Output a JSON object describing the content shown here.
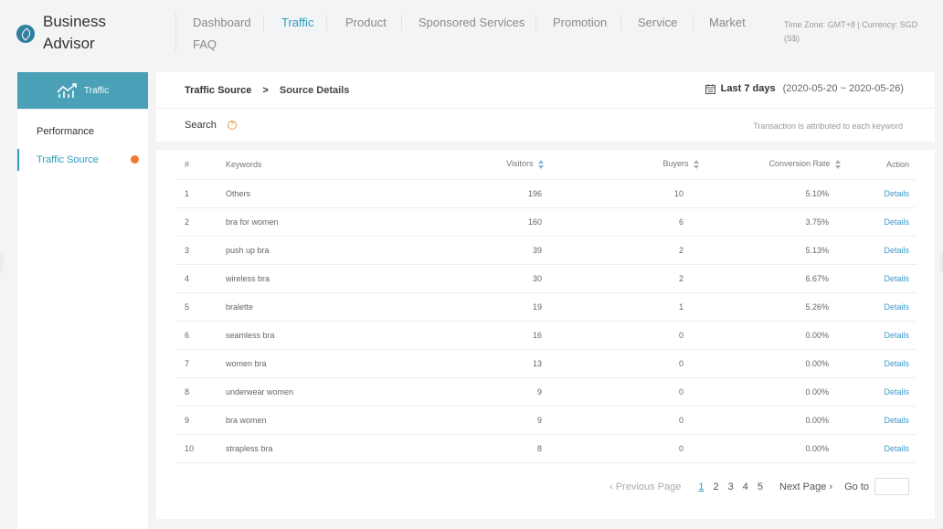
{
  "app": {
    "title_line1": "Business",
    "title_line2": "Advisor"
  },
  "nav": {
    "items": [
      {
        "label": "Dashboard",
        "active": false
      },
      {
        "label": "Traffic",
        "active": true
      },
      {
        "label": "Product",
        "active": false
      },
      {
        "label": "Sponsored Services",
        "active": false
      },
      {
        "label": "Promotion",
        "active": false
      },
      {
        "label": "Service",
        "active": false
      },
      {
        "label": "Market",
        "active": false
      },
      {
        "label": "FAQ",
        "active": false
      }
    ],
    "timezone_line1": "Time Zone: GMT+8 | Currency: SGD",
    "timezone_line2": "(S$)"
  },
  "sidebar": {
    "header_label": "Traffic",
    "items": [
      {
        "label": "Performance",
        "active": false
      },
      {
        "label": "Traffic Source",
        "active": true
      }
    ]
  },
  "breadcrumb": {
    "root": "Traffic Source",
    "separator": ">",
    "current": "Source Details"
  },
  "date": {
    "label": "Last 7 days",
    "range": "(2020-05-20 ~ 2020-05-26)"
  },
  "search": {
    "label": "Search",
    "help": "?",
    "note": "Transaction is attributed to each keyword"
  },
  "table": {
    "headers": {
      "num": "#",
      "keywords": "Keywords",
      "visitors": "Visitors",
      "buyers": "Buyers",
      "conversion": "Conversion Rate",
      "action": "Action"
    },
    "rows": [
      {
        "num": "1",
        "keyword": "Others",
        "visitors": "196",
        "buyers": "10",
        "conversion": "5.10%",
        "action": "Details"
      },
      {
        "num": "2",
        "keyword": "bra for women",
        "visitors": "160",
        "buyers": "6",
        "conversion": "3.75%",
        "action": "Details"
      },
      {
        "num": "3",
        "keyword": "push up bra",
        "visitors": "39",
        "buyers": "2",
        "conversion": "5.13%",
        "action": "Details"
      },
      {
        "num": "4",
        "keyword": "wireless bra",
        "visitors": "30",
        "buyers": "2",
        "conversion": "6.67%",
        "action": "Details"
      },
      {
        "num": "5",
        "keyword": "bralette",
        "visitors": "19",
        "buyers": "1",
        "conversion": "5.26%",
        "action": "Details"
      },
      {
        "num": "6",
        "keyword": "seamless bra",
        "visitors": "16",
        "buyers": "0",
        "conversion": "0.00%",
        "action": "Details"
      },
      {
        "num": "7",
        "keyword": "women bra",
        "visitors": "13",
        "buyers": "0",
        "conversion": "0.00%",
        "action": "Details"
      },
      {
        "num": "8",
        "keyword": "underwear women",
        "visitors": "9",
        "buyers": "0",
        "conversion": "0.00%",
        "action": "Details"
      },
      {
        "num": "9",
        "keyword": "bra women",
        "visitors": "9",
        "buyers": "0",
        "conversion": "0.00%",
        "action": "Details"
      },
      {
        "num": "10",
        "keyword": "strapless bra",
        "visitors": "8",
        "buyers": "0",
        "conversion": "0.00%",
        "action": "Details"
      }
    ]
  },
  "pagination": {
    "prev": "‹ Previous Page",
    "pages": [
      "1",
      "2",
      "3",
      "4",
      "5"
    ],
    "current": "1",
    "next": "Next Page ›",
    "goto": "Go to"
  },
  "colors": {
    "accent": "#2f9bc0",
    "sidebar_header": "#4aa0b6",
    "notification_dot": "#ee7b30"
  }
}
